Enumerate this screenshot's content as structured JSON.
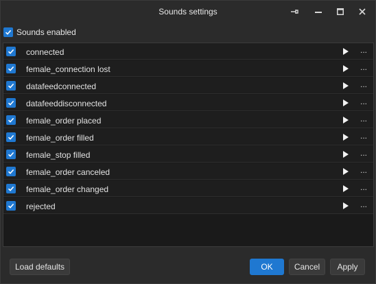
{
  "window": {
    "title": "Sounds settings",
    "controls": {
      "pin": "pin-icon",
      "minimize": "minimize-icon",
      "maximize": "maximize-icon",
      "close": "close-icon"
    }
  },
  "master": {
    "label": "Sounds enabled",
    "checked": true
  },
  "sounds": [
    {
      "name": "connected",
      "checked": true
    },
    {
      "name": "female_connection lost",
      "checked": true
    },
    {
      "name": "datafeedconnected",
      "checked": true
    },
    {
      "name": "datafeeddisconnected",
      "checked": true
    },
    {
      "name": "female_order placed",
      "checked": true
    },
    {
      "name": "female_order filled",
      "checked": true
    },
    {
      "name": "female_stop filled",
      "checked": true
    },
    {
      "name": "female_order canceled",
      "checked": true
    },
    {
      "name": "female_order changed",
      "checked": true
    },
    {
      "name": "rejected",
      "checked": true
    }
  ],
  "row_more_label": "...",
  "buttons": {
    "load_defaults": "Load defaults",
    "ok": "OK",
    "cancel": "Cancel",
    "apply": "Apply"
  },
  "colors": {
    "accent": "#1f78d1",
    "background": "#2b2b2b",
    "list_background": "#1a1a1a"
  }
}
